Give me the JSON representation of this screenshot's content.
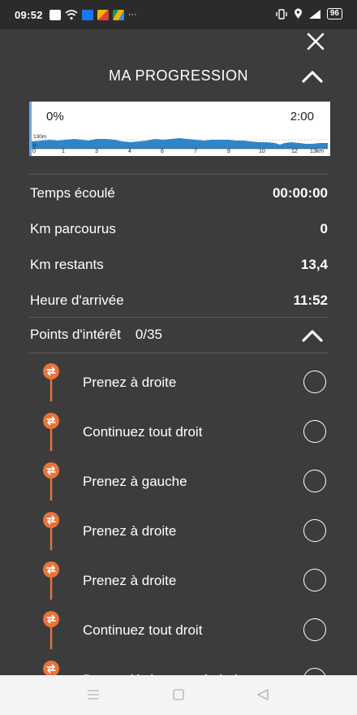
{
  "status_bar": {
    "time": "09:52",
    "battery": "96",
    "more": "···"
  },
  "header": {
    "title": "MA PROGRESSION"
  },
  "elevation": {
    "start_label": "0%",
    "end_label": "2:00",
    "altitude_label": "130m",
    "altitude_zero": "0",
    "km_ticks": [
      "0",
      "1",
      "3",
      "4",
      "6",
      "7",
      "9",
      "10",
      "12",
      "13km"
    ]
  },
  "stats": [
    {
      "label": "Temps écoulé",
      "value": "00:00:00"
    },
    {
      "label": "Km parcourus",
      "value": "0"
    },
    {
      "label": "Km restants",
      "value": "13,4"
    },
    {
      "label": "Heure d'arrivée",
      "value": "11:52"
    }
  ],
  "poi": {
    "title": "Points d'intérêt",
    "count": "0/35",
    "items": [
      {
        "label": "Prenez à droite"
      },
      {
        "label": "Continuez tout droit"
      },
      {
        "label": "Prenez à gauche"
      },
      {
        "label": "Prenez à droite"
      },
      {
        "label": "Prenez à droite"
      },
      {
        "label": "Continuez tout droit"
      },
      {
        "label": "Prenez légèrement à droite"
      }
    ]
  },
  "colors": {
    "background": "#3c3c3c",
    "pin": "#e8743b",
    "elevation_fill": "#2e86c8"
  },
  "icons": [
    "close-icon",
    "chevron-up-icon",
    "poi-pin-icon",
    "checkbox-circle-icon",
    "nav-menu-icon",
    "nav-home-icon",
    "nav-back-icon"
  ]
}
